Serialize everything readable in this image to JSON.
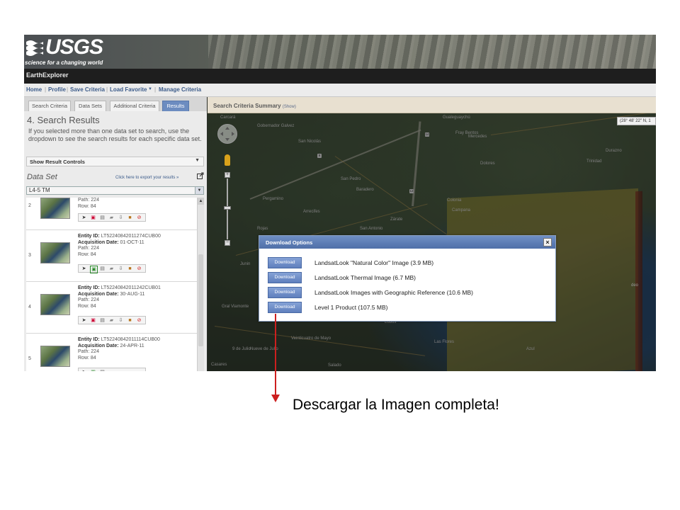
{
  "header": {
    "logo": "USGS",
    "tagline": "science for a changing world",
    "app_title": "EarthExplorer"
  },
  "menu": {
    "items": [
      "Home",
      "Profile",
      "Save Criteria",
      "Load Favorite",
      "Manage Criteria"
    ],
    "dropdown_glyph": "▼"
  },
  "left_panel": {
    "tabs": [
      "Search Criteria",
      "Data Sets",
      "Additional Criteria",
      "Results"
    ],
    "active_tab": "Results",
    "title": "4. Search Results",
    "description": "If you selected more than one data set to search, use the dropdown to see the search results for each specific data set.",
    "show_controls": "Show Result Controls",
    "data_set_label": "Data Set",
    "export_link": "Click here to export your results »",
    "data_set_value": "L4-5 TM",
    "results": [
      {
        "num": "2",
        "entity_id": "",
        "date": "",
        "path": "Path: 224",
        "row": "Row: 84"
      },
      {
        "num": "3",
        "entity_id": "LT52240842011274CUB00",
        "date": "01-OCT-11",
        "path": "Path: 224",
        "row": "Row: 84"
      },
      {
        "num": "4",
        "entity_id": "LT52240842011242CUB01",
        "date": "30-AUG-11",
        "path": "Path: 224",
        "row": "Row: 84"
      },
      {
        "num": "5",
        "entity_id": "LT52240842011114CUB00",
        "date": "24-APR-11",
        "path": "Path: 224",
        "row": "Row: 84"
      }
    ],
    "labels": {
      "entity": "Entity ID:",
      "acq": "Acquisition Date:"
    }
  },
  "map_panel": {
    "summary_title": "Search Criteria Summary",
    "summary_toggle": "(Show)",
    "coordinates": "(28° 48' 22\" N, 1",
    "cities": [
      "Carcará",
      "Gobernador Galvez",
      "San Nicolás",
      "Gualeguaychú",
      "Fray Bentos",
      "Mercedes",
      "Pergamino",
      "Arrecifes",
      "San Pedro",
      "Baradero",
      "Zárate",
      "Campana",
      "Durazno",
      "Trinidad",
      "Dolores",
      "Colonia",
      "Rojas",
      "San Antonio",
      "Junin",
      "9 de Julio",
      "Veinticuatro de Mayo",
      "Salado",
      "Las Flores",
      "Lobos",
      "Azul",
      "Gral Viamonte",
      "Nueve de Julio",
      "Casares"
    ]
  },
  "dialog": {
    "title": "Download Options",
    "close": "×",
    "button_label": "Download",
    "options": [
      "LandsatLook \"Natural Color\" Image (3.9 MB)",
      "LandsatLook Thermal Image (6.7 MB)",
      "LandsatLook Images with Geographic Reference (10.6 MB)",
      "Level 1 Product (107.5 MB)"
    ]
  },
  "annotation": {
    "caption": "Descargar la Imagen completa!",
    "color": "#cc1f1f"
  },
  "colors": {
    "accent": "#5f7fbd",
    "active_tab": "#6c8cc0",
    "link": "#3b5b8a"
  }
}
